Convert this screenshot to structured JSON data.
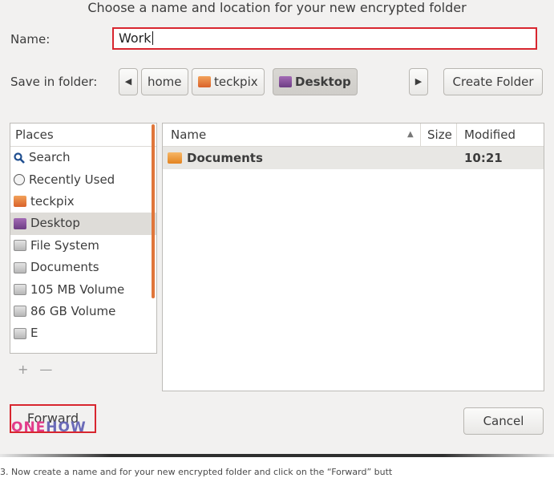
{
  "dialog": {
    "title": "Choose a name and location for your new encrypted folder",
    "name_label": "Name:",
    "name_value": "Work",
    "save_in_label": "Save in folder:",
    "breadcrumb": [
      {
        "label": "home",
        "icon": "none"
      },
      {
        "label": "teckpix",
        "icon": "home-folder-icon"
      },
      {
        "label": "Desktop",
        "icon": "desktop-folder-icon",
        "active": true
      }
    ],
    "create_folder_label": "Create Folder"
  },
  "places": {
    "header": "Places",
    "items": [
      {
        "label": "Search",
        "icon": "search-icon"
      },
      {
        "label": "Recently Used",
        "icon": "clock-icon"
      },
      {
        "label": "teckpix",
        "icon": "home-folder-icon"
      },
      {
        "label": "Desktop",
        "icon": "desktop-folder-icon",
        "selected": true
      },
      {
        "label": "File System",
        "icon": "drive-icon"
      },
      {
        "label": "Documents",
        "icon": "drive-icon"
      },
      {
        "label": "105 MB Volume",
        "icon": "drive-icon"
      },
      {
        "label": "86 GB Volume",
        "icon": "drive-icon"
      },
      {
        "label": "E",
        "icon": "drive-icon"
      }
    ],
    "add_symbol": "+",
    "remove_symbol": "—"
  },
  "files": {
    "columns": {
      "name": "Name",
      "size": "Size",
      "modified": "Modified"
    },
    "sort_indicator": "▲",
    "rows": [
      {
        "name": "Documents",
        "size": "",
        "modified": "10:21",
        "icon": "folder-icon"
      }
    ]
  },
  "footer": {
    "forward_label": "Forward",
    "cancel_label": "Cancel",
    "watermark": {
      "part1": "ONE",
      "part2": "HOW"
    }
  },
  "caption": "3. Now create a name and for your new encrypted folder and click on the “Forward” butt",
  "colors": {
    "highlight_border": "#d8262f",
    "scroll_accent": "#e0763b"
  }
}
